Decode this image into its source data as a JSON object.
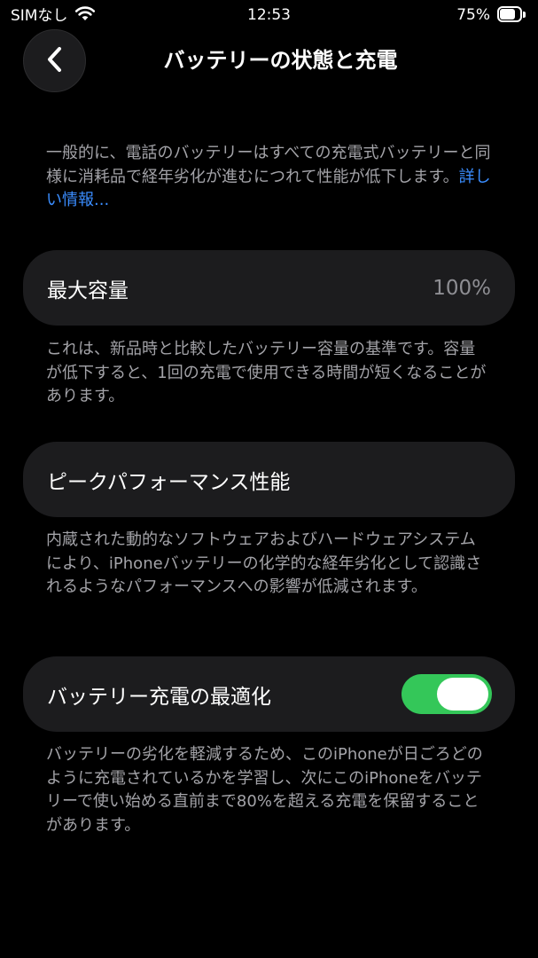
{
  "status_bar": {
    "carrier": "SIMなし",
    "time": "12:53",
    "battery_percent": "75%",
    "battery_level": 0.75,
    "icons": [
      "wifi-icon",
      "battery-icon"
    ]
  },
  "nav": {
    "title": "バッテリーの状態と充電",
    "back_icon": "chevron-left-icon"
  },
  "intro": {
    "text": "一般的に、電話のバッテリーはすべての充電式バッテリーと同様に消耗品で経年劣化が進むにつれて性能が低下します。",
    "link_label": "詳しい情報..."
  },
  "max_capacity": {
    "label": "最大容量",
    "value": "100%",
    "footnote": "これは、新品時と比較したバッテリー容量の基準です。容量が低下すると、1回の充電で使用できる時間が短くなることがあります。"
  },
  "peak_performance": {
    "label": "ピークパフォーマンス性能",
    "footnote": "内蔵された動的なソフトウェアおよびハードウェアシステムにより、iPhoneバッテリーの化学的な経年劣化として認識されるようなパフォーマンスへの影響が低減されます。"
  },
  "optimized_charging": {
    "label": "バッテリー充電の最適化",
    "enabled": true,
    "footnote": "バッテリーの劣化を軽減するため、このiPhoneが日ごろどのように充電されているかを学習し、次にこのiPhoneをバッテリーで使い始める直前まで80%を超える充電を保留することがあります。"
  },
  "colors": {
    "background": "#000000",
    "card": "#1c1c1e",
    "secondary_text": "#a3a3a8",
    "link": "#3a8dff",
    "toggle_on": "#34c759"
  }
}
